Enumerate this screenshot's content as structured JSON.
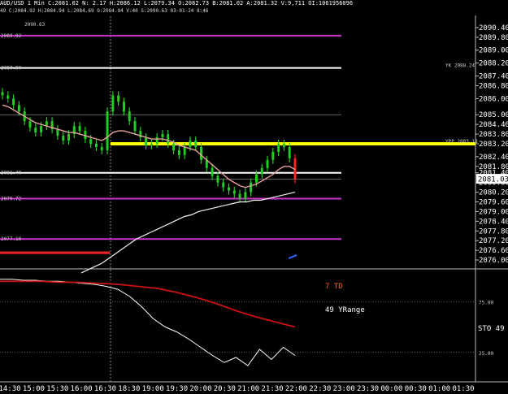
{
  "header": {
    "line1": "AUD/USD 1 Min  C:2081.02  N:  2.17  H:2086.12  L:2079.34  O:2082.73  B:2081.02  A:2081.32  V:9,711  OI:1061956096",
    "line2": "49 C:2084.92 H:2084.94 L:2084.69 O:2084.94 V:40 S:2090.63 03-01-24 8:46"
  },
  "colors": {
    "background": "#000000",
    "candle": "#22cc22",
    "magenta_level": "#cc33cc",
    "white_level": "#ffffff",
    "yellow_level": "#ffff00",
    "red_level": "#ff2222",
    "ma_pink": "#e8a0a0",
    "ma_white": "#f0f0f0",
    "td_red": "#cc1111"
  },
  "chart_data": [
    {
      "type": "line",
      "panel": "price",
      "ylim": [
        2075.8,
        2091.0
      ],
      "y_ticks": [
        "2090.40",
        "2089.80",
        "2089.00",
        "2088.20",
        "2087.40",
        "2086.80",
        "2086.00",
        "2085.00",
        "2084.40",
        "2083.80",
        "2083.20",
        "2082.40",
        "2081.80",
        "2081.40",
        "2080.80",
        "2080.20",
        "2079.60",
        "2079.00",
        "2078.40",
        "2077.80",
        "2077.20",
        "2076.60",
        "2076.00"
      ],
      "last_price_label": "2081.03",
      "x_ticks": [
        "14:30",
        "15:00",
        "15:30",
        "16:00",
        "16:30",
        "18:30",
        "19:00",
        "19:30",
        "20:00",
        "20:30",
        "21:00",
        "21:30",
        "22:00",
        "22:30",
        "23:00",
        "23:30",
        "00:00",
        "00:30",
        "01:00",
        "01:30"
      ],
      "levels": [
        {
          "value": 2089.9,
          "color": "#cc33cc",
          "left_label": "2089.92",
          "right_label": ""
        },
        {
          "value": 2087.9,
          "color": "#ffffff",
          "left_label": "2087.90",
          "right_label": "YK 2088.24"
        },
        {
          "value": 2083.2,
          "color": "#ffff00",
          "left_label": "",
          "right_label": "YPP 2083.18"
        },
        {
          "value": 2081.4,
          "color": "#ffffff",
          "left_label": "2081.40",
          "right_label": ""
        },
        {
          "value": 2079.8,
          "color": "#cc33cc",
          "left_label": "2079.72",
          "right_label": ""
        },
        {
          "value": 2077.3,
          "color": "#cc33cc",
          "left_label": "2077.10",
          "right_label": ""
        }
      ],
      "thin_levels": [
        2085.0,
        2081.0
      ],
      "price_close": [
        2086.2,
        2086.0,
        2085.6,
        2085.2,
        2084.6,
        2084.2,
        2083.9,
        2084.3,
        2084.6,
        2084.1,
        2083.7,
        2083.4,
        2083.8,
        2084.3,
        2084.0,
        2083.5,
        2083.2,
        2083.0,
        2082.8,
        2085.2,
        2086.2,
        2085.8,
        2085.2,
        2084.6,
        2084.0,
        2083.6,
        2083.1,
        2083.2,
        2083.6,
        2083.8,
        2083.2,
        2082.8,
        2082.5,
        2083.0,
        2083.4,
        2083.0,
        2082.2,
        2081.7,
        2081.2,
        2080.8,
        2080.5,
        2080.3,
        2080.1,
        2079.8,
        2080.2,
        2080.8,
        2081.3,
        2081.7,
        2082.2,
        2082.7,
        2083.2,
        2083.0,
        2082.3,
        2081.0
      ],
      "ma_pink": [
        2085.6,
        2085.5,
        2085.3,
        2085.1,
        2084.9,
        2084.7,
        2084.5,
        2084.4,
        2084.3,
        2084.2,
        2084.1,
        2084.0,
        2083.9,
        2083.9,
        2083.8,
        2083.7,
        2083.6,
        2083.5,
        2083.4,
        2083.6,
        2083.9,
        2084.0,
        2084.0,
        2083.9,
        2083.8,
        2083.7,
        2083.6,
        2083.5,
        2083.5,
        2083.5,
        2083.4,
        2083.3,
        2083.1,
        2083.0,
        2082.9,
        2082.8,
        2082.5,
        2082.2,
        2081.9,
        2081.6,
        2081.3,
        2081.0,
        2080.8,
        2080.6,
        2080.5,
        2080.6,
        2080.7,
        2080.9,
        2081.1,
        2081.3,
        2081.6,
        2081.8,
        2081.8,
        2081.6
      ],
      "ma_white": [
        2075.2,
        2075.4,
        2075.6,
        2075.8,
        2076.1,
        2076.4,
        2076.7,
        2077.0,
        2077.3,
        2077.5,
        2077.7,
        2077.9,
        2078.1,
        2078.3,
        2078.5,
        2078.7,
        2078.8,
        2079.0,
        2079.1,
        2079.2,
        2079.3,
        2079.4,
        2079.5,
        2079.6,
        2079.6,
        2079.7,
        2079.7,
        2079.8,
        2079.9,
        2080.0,
        2080.1,
        2080.2
      ],
      "red_level_value": 2076.45,
      "blue_tick_value": 2076.2
    },
    {
      "type": "line",
      "panel": "stochastic",
      "ylim": [
        0,
        100
      ],
      "y_ticks": [
        "75.00",
        "25.00"
      ],
      "labels": {
        "td": "7 TD",
        "yrange": "49 YRange",
        "sto": "STO  49"
      },
      "sto_white": [
        97,
        97,
        96,
        96,
        95,
        95,
        94,
        93,
        92,
        90,
        87,
        80,
        70,
        58,
        50,
        45,
        38,
        30,
        22,
        15,
        20,
        12,
        28,
        18,
        30,
        22
      ],
      "td_red": [
        95,
        95,
        95,
        94,
        94,
        93,
        92,
        90,
        88,
        84,
        79,
        73,
        66,
        60,
        55,
        50
      ]
    }
  ]
}
